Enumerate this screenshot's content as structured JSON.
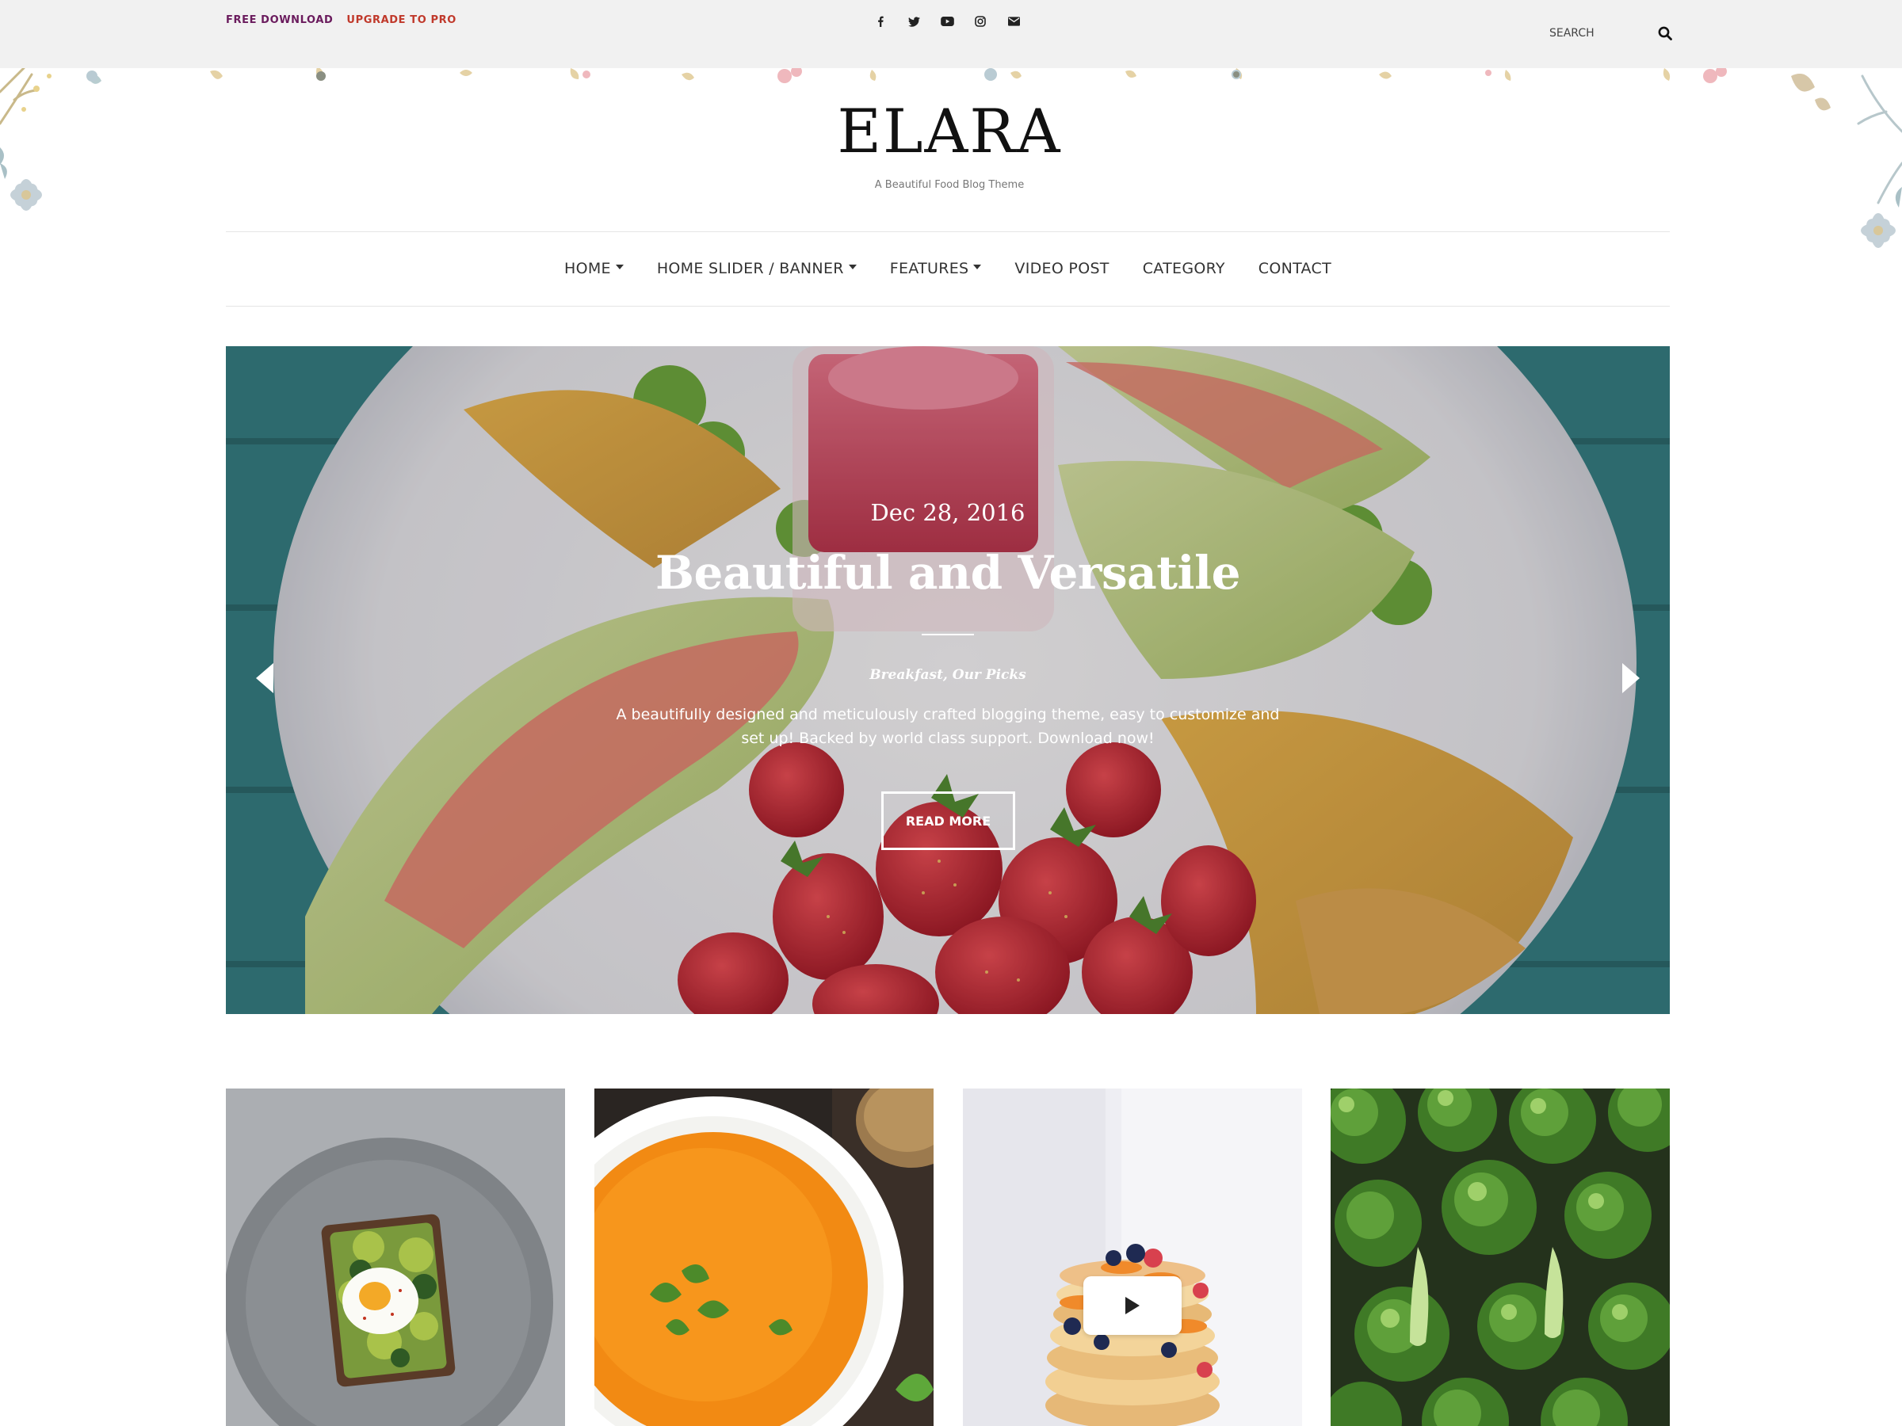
{
  "topbar": {
    "free_download": "FREE DOWNLOAD",
    "upgrade": "UPGRADE TO PRO",
    "free_download_color": "#6a1b5d",
    "upgrade_color": "#c0392b",
    "social_icons": [
      "facebook-icon",
      "twitter-icon",
      "youtube-icon",
      "instagram-icon",
      "email-icon"
    ],
    "search_placeholder": "SEARCH"
  },
  "brand": {
    "title": "ELARA",
    "tagline": "A Beautiful Food Blog Theme"
  },
  "nav": {
    "items": [
      {
        "label": "HOME",
        "has_dropdown": true
      },
      {
        "label": "HOME SLIDER / BANNER",
        "has_dropdown": true
      },
      {
        "label": "FEATURES",
        "has_dropdown": true
      },
      {
        "label": "VIDEO POST",
        "has_dropdown": false
      },
      {
        "label": "CATEGORY",
        "has_dropdown": false
      },
      {
        "label": "CONTACT",
        "has_dropdown": false
      }
    ]
  },
  "hero": {
    "date": "Dec 28, 2016",
    "title": "Beautiful and Versatile",
    "categories": "Breakfast, Our Picks",
    "excerpt": "A beautifully designed and meticulously crafted blogging theme, easy to customize and set up! Backed by world class support. Download now!",
    "button": "READ MORE",
    "image": "melon-strawberry-plate"
  },
  "posts": [
    {
      "image": "avocado-toast-egg"
    },
    {
      "image": "carrot-soup-bowl"
    },
    {
      "image": "pancake-stack",
      "video": true
    },
    {
      "image": "broccoli"
    }
  ],
  "colors": {
    "topbar_bg": "#f1f1f1",
    "accent_purple": "#6a1b5d",
    "accent_red": "#c0392b"
  }
}
